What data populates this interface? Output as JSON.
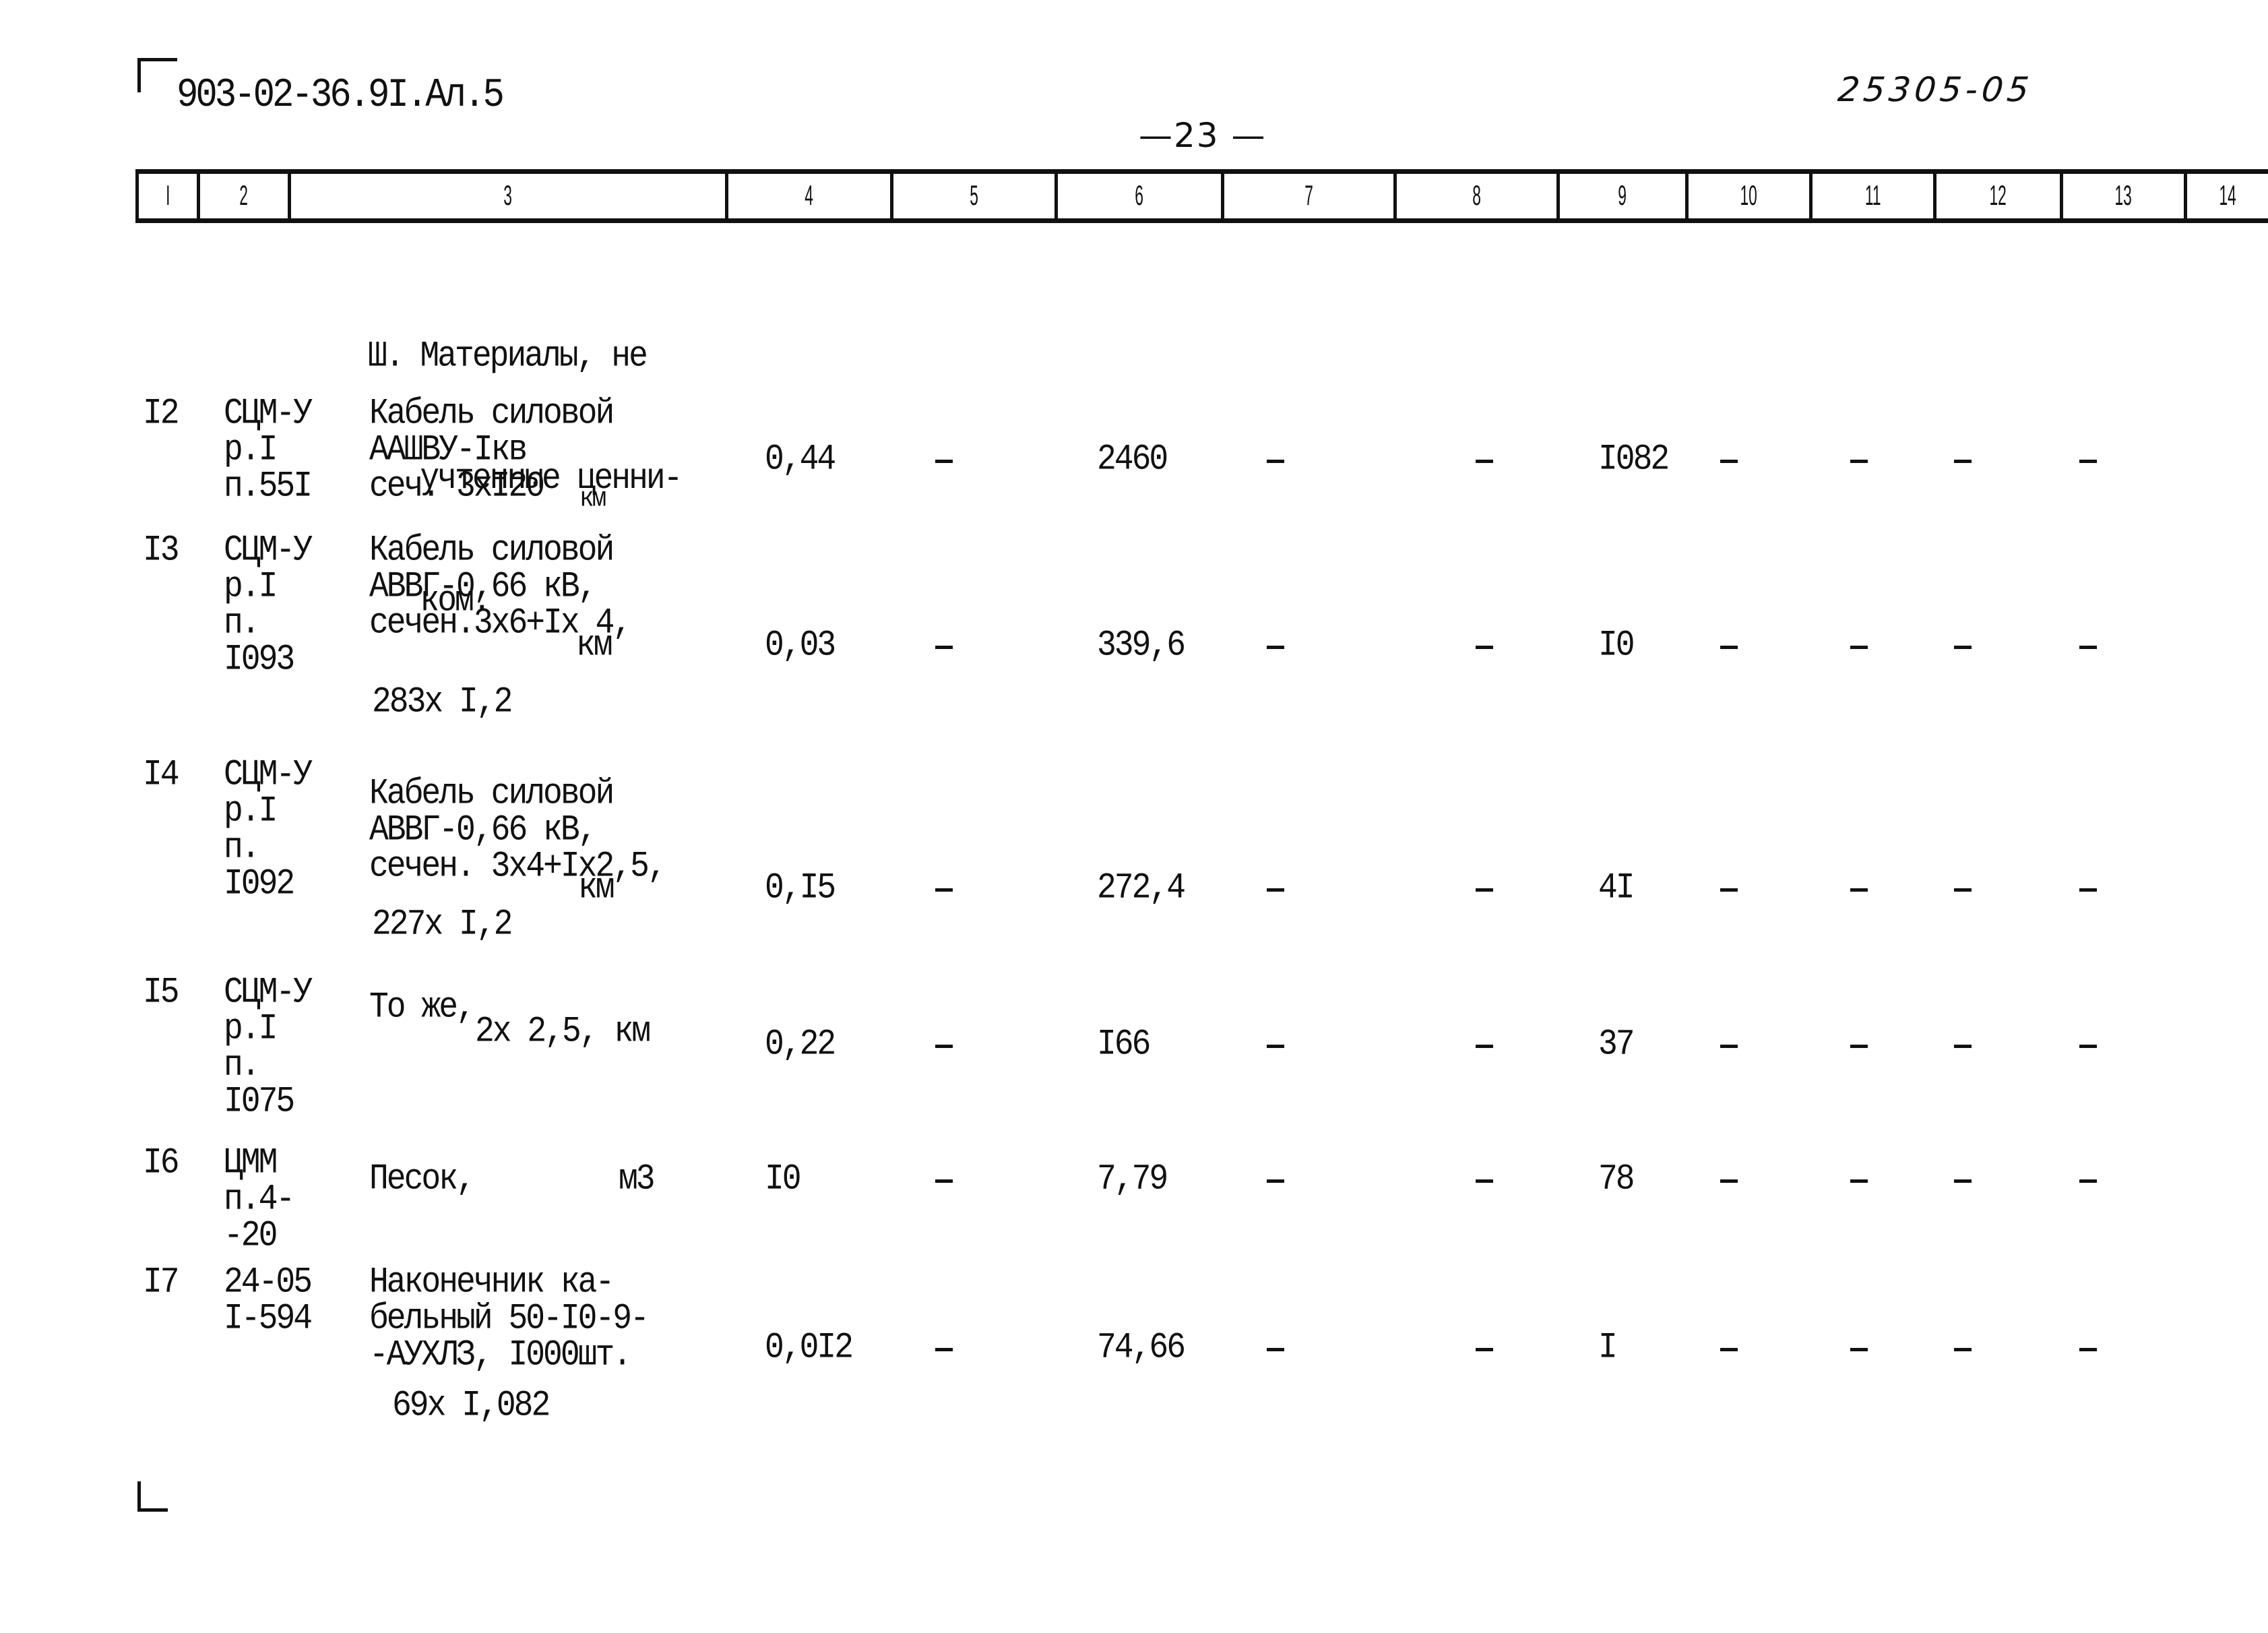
{
  "document": {
    "code": "903-02-36.9I.Ал.5",
    "stamp": "25305-05",
    "page_number": "—23 —"
  },
  "table": {
    "column_numbers": [
      "I",
      "2",
      "3",
      "4",
      "5",
      "6",
      "7",
      "8",
      "9",
      "10",
      "11",
      "12",
      "13",
      "14"
    ],
    "section_heading": [
      "Ш. Материалы, не",
      "   учтенные ценни-",
      "   ком."
    ],
    "rows": [
      {
        "num": "I2",
        "ref": [
          "СЦМ-У",
          "р.I",
          "п.55I"
        ],
        "desc": [
          "Кабель силовой",
          "ААШВУ-Iкв",
          "сеч. 3xI20"
        ],
        "unit": "км",
        "calc": "",
        "col4": "0,44",
        "col5": "–",
        "col6": "2460",
        "col7": "–",
        "col8": "–",
        "col9": "I082",
        "col10": "–",
        "col11": "–",
        "col12": "–",
        "col13": "–"
      },
      {
        "num": "I3",
        "ref": [
          "СЦМ-У",
          "р.I",
          "п.",
          "I093"
        ],
        "desc": [
          "Кабель силовой",
          "АВВГ-0,66 кВ,",
          "сечен.3x6+Ix 4,"
        ],
        "unit": "км",
        "calc": "283x I,2",
        "col4": "0,03",
        "col5": "–",
        "col6": "339,6",
        "col7": "–",
        "col8": "–",
        "col9": "I0",
        "col10": "–",
        "col11": "–",
        "col12": "–",
        "col13": "–"
      },
      {
        "num": "I4",
        "ref": [
          "СЦМ-У",
          "р.I",
          "п.",
          "I092"
        ],
        "desc": [
          "Кабель силовой",
          "АВВГ-0,66 кВ,",
          "сечен. 3x4+Ix2,5,"
        ],
        "unit": "км",
        "calc": "227x I,2",
        "col4": "0,I5",
        "col5": "–",
        "col6": "272,4",
        "col7": "–",
        "col8": "–",
        "col9": "4I",
        "col10": "–",
        "col11": "–",
        "col12": "–",
        "col13": "–"
      },
      {
        "num": "I5",
        "ref": [
          "СЦМ-У",
          "р.I",
          "п.",
          "I075"
        ],
        "desc": [
          "То же,",
          "2x 2,5, км"
        ],
        "unit": "",
        "calc": "",
        "col4": "0,22",
        "col5": "–",
        "col6": "I66",
        "col7": "–",
        "col8": "–",
        "col9": "37",
        "col10": "–",
        "col11": "–",
        "col12": "–",
        "col13": "–"
      },
      {
        "num": "I6",
        "ref": [
          "ЦММ",
          "п.4-",
          "-20"
        ],
        "desc": [
          "Песок,"
        ],
        "unit": "м3",
        "calc": "",
        "col4": "I0",
        "col5": "–",
        "col6": "7,79",
        "col7": "–",
        "col8": "–",
        "col9": "78",
        "col10": "–",
        "col11": "–",
        "col12": "–",
        "col13": "–"
      },
      {
        "num": "I7",
        "ref": [
          "24-05",
          "I-594"
        ],
        "desc": [
          "Наконечник ка-",
          "бельный 50-I0-9-",
          "-АУХЛЗ, I000шт."
        ],
        "unit": "",
        "calc": "69x I,082",
        "col4": "0,0I2",
        "col5": "–",
        "col6": "74,66",
        "col7": "–",
        "col8": "–",
        "col9": "I",
        "col10": "–",
        "col11": "–",
        "col12": "–",
        "col13": "–"
      }
    ]
  }
}
